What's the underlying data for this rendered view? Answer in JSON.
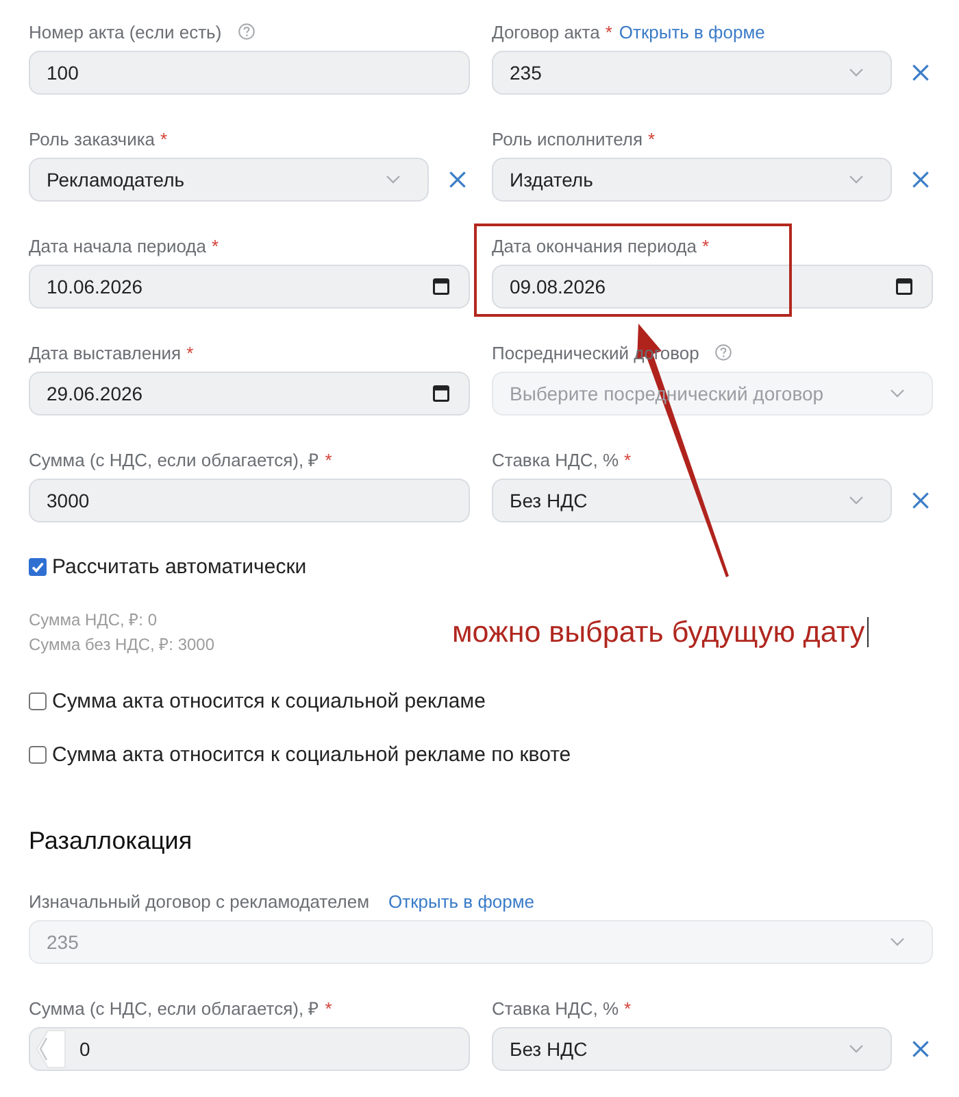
{
  "form": {
    "rows": [
      {
        "left": {
          "kind": "text",
          "label": "Номер акта (если есть)",
          "help": true,
          "value": "100",
          "clearable": false,
          "disabled": false,
          "highlighted": false,
          "covered_by_back_button": false
        },
        "right": {
          "kind": "select",
          "label": "Договор акта",
          "required_mark": "*",
          "link": "Открыть в форме",
          "help": false,
          "value": "235",
          "clearable": true,
          "disabled": false,
          "highlighted": false,
          "covered_by_back_button": false
        }
      },
      {
        "left": {
          "kind": "select",
          "label": "Роль заказчика",
          "required_mark": "*",
          "help": false,
          "value": "Рекламодатель",
          "clearable": true,
          "disabled": false,
          "highlighted": false,
          "covered_by_back_button": false
        },
        "right": {
          "kind": "select",
          "label": "Роль исполнителя",
          "required_mark": "*",
          "help": false,
          "value": "Издатель",
          "clearable": true,
          "disabled": false,
          "highlighted": false,
          "covered_by_back_button": false
        }
      },
      {
        "left": {
          "kind": "date",
          "label": "Дата начала периода",
          "required_mark": "*",
          "help": false,
          "value": "10.06.2026",
          "clearable": false,
          "disabled": false,
          "highlighted": false,
          "covered_by_back_button": false
        },
        "right": {
          "kind": "date",
          "label": "Дата окончания периода",
          "required_mark": "*",
          "help": false,
          "value": "09.08.2026",
          "clearable": false,
          "disabled": false,
          "highlighted": true,
          "covered_by_back_button": false
        }
      },
      {
        "left": {
          "kind": "date",
          "label": "Дата выставления",
          "required_mark": "*",
          "help": false,
          "value": "29.06.2026",
          "clearable": false,
          "disabled": false,
          "highlighted": false,
          "covered_by_back_button": false
        },
        "right": {
          "kind": "select",
          "label": "Посреднический договор",
          "help": true,
          "placeholder": "Выберите посреднический договор",
          "clearable": false,
          "disabled": true,
          "highlighted": false,
          "covered_by_back_button": false
        }
      },
      {
        "left": {
          "kind": "text",
          "label": "Сумма (с НДС, если облагается), ₽",
          "required_mark": "*",
          "help": false,
          "value": "3000",
          "clearable": false,
          "disabled": false,
          "highlighted": false,
          "covered_by_back_button": false
        },
        "right": {
          "kind": "select",
          "label": "Ставка НДС, %",
          "required_mark": "*",
          "help": false,
          "value": "Без НДС",
          "clearable": true,
          "disabled": false,
          "highlighted": false,
          "covered_by_back_button": false
        }
      }
    ],
    "auto_calc": {
      "label": "Рассчитать автоматически",
      "checked": true
    },
    "totals": [
      "Сумма НДС, ₽: 0",
      "Сумма без НДС, ₽: 3000"
    ],
    "social_ad": [
      {
        "label": "Сумма акта относится к социальной рекламе",
        "checked": false
      },
      {
        "label": "Сумма акта относится к социальной рекламе по квоте",
        "checked": false
      }
    ]
  },
  "reallocation": {
    "title": "Разаллокация",
    "contract": {
      "kind": "select",
      "label": "Изначальный договор с рекламодателем",
      "link": "Открыть в форме",
      "help": false,
      "value": "235",
      "clearable": false,
      "disabled": true,
      "highlighted": false,
      "covered_by_back_button": false
    },
    "rows": [
      {
        "left": {
          "kind": "text",
          "label": "Сумма (с НДС, если облагается), ₽",
          "required_mark": "*",
          "help": false,
          "value": "0",
          "clearable": false,
          "disabled": false,
          "highlighted": false,
          "covered_by_back_button": true
        },
        "right": {
          "kind": "select",
          "label": "Ставка НДС, %",
          "required_mark": "*",
          "help": false,
          "value": "Без НДС",
          "clearable": true,
          "disabled": false,
          "highlighted": false,
          "covered_by_back_button": false
        }
      }
    ]
  },
  "annotation": {
    "text": "можно выбрать будущую дату",
    "caret": true,
    "arrow": true
  }
}
